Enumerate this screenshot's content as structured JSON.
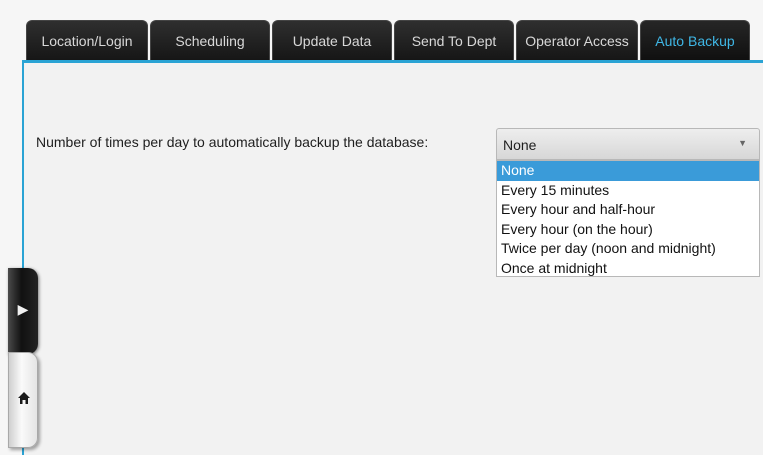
{
  "tabs": [
    {
      "label": "Location/Login",
      "active": false
    },
    {
      "label": "Scheduling",
      "active": false
    },
    {
      "label": "Update Data",
      "active": false
    },
    {
      "label": "Send To Dept",
      "active": false
    },
    {
      "label": "Operator Access",
      "active": false
    },
    {
      "label": "Auto Backup",
      "active": true
    }
  ],
  "backup": {
    "label": "Number of times per day to automatically backup the database:",
    "selected": "None",
    "options": [
      "None",
      "Every 15 minutes",
      "Every hour and half-hour",
      "Every hour (on the hour)",
      "Twice per day (noon and midnight)",
      "Once at midnight"
    ]
  },
  "side_panel": {
    "expand_icon": "arrow-right-icon",
    "home_icon": "home-icon"
  },
  "colors": {
    "accent": "#2aa3d4",
    "active_tab_text": "#3fb7e6",
    "selected_option": "#3a9bd9",
    "tab_background": "#1e1e1e"
  }
}
